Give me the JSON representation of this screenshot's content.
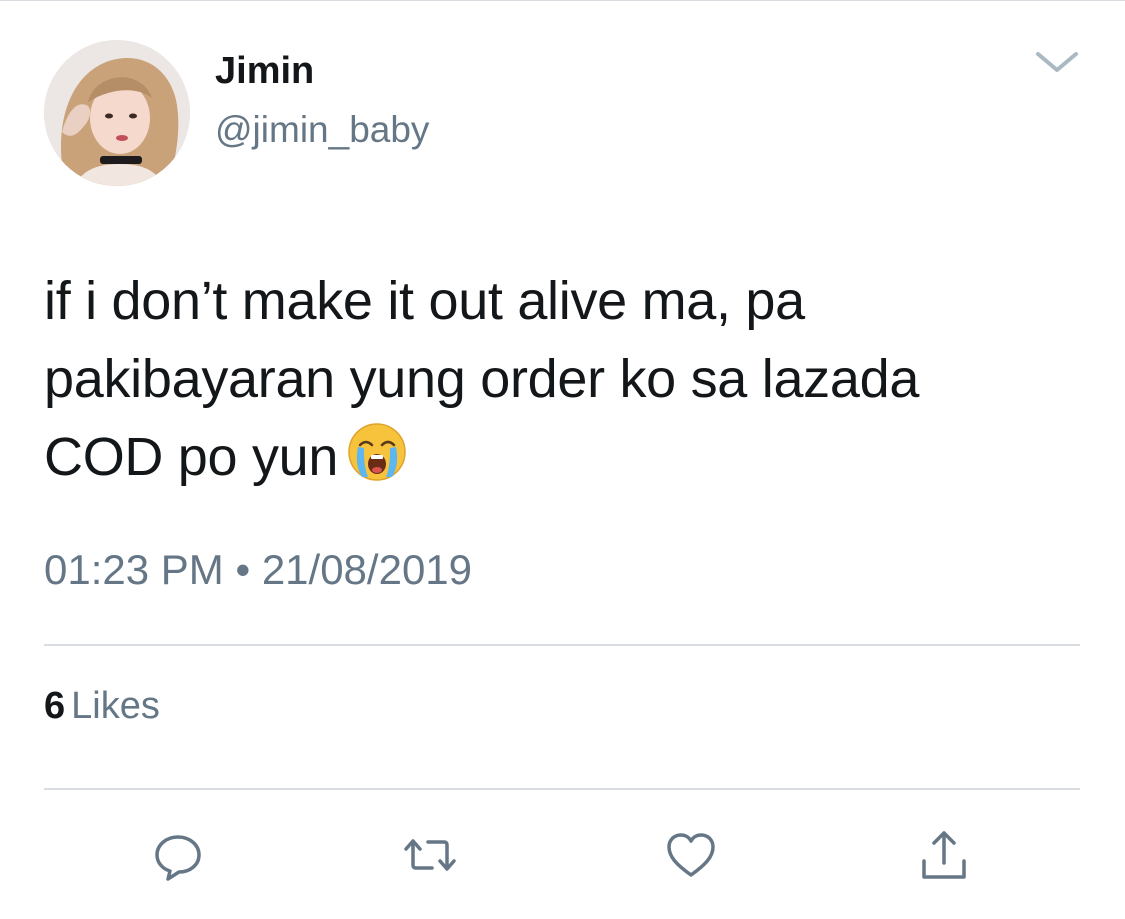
{
  "tweet": {
    "author": {
      "display_name": "Jimin",
      "handle": "@jimin_baby",
      "avatar_icon": "profile-photo"
    },
    "text_lines": [
      "if i don’t make it out alive ma, pa",
      "pakibayaran yung order ko sa lazada",
      "COD po yun"
    ],
    "emoji": "loudly-crying-face",
    "timestamp": "01:23 PM • 21/08/2019",
    "likes": {
      "count": "6",
      "label": "Likes"
    },
    "actions": [
      {
        "icon": "reply-icon"
      },
      {
        "icon": "retweet-icon"
      },
      {
        "icon": "like-icon"
      },
      {
        "icon": "share-icon"
      }
    ],
    "menu_icon": "chevron-down-icon"
  },
  "colors": {
    "text_primary": "#14171a",
    "text_secondary": "#657786",
    "divider": "#d9dde1",
    "icon": "#657786"
  }
}
